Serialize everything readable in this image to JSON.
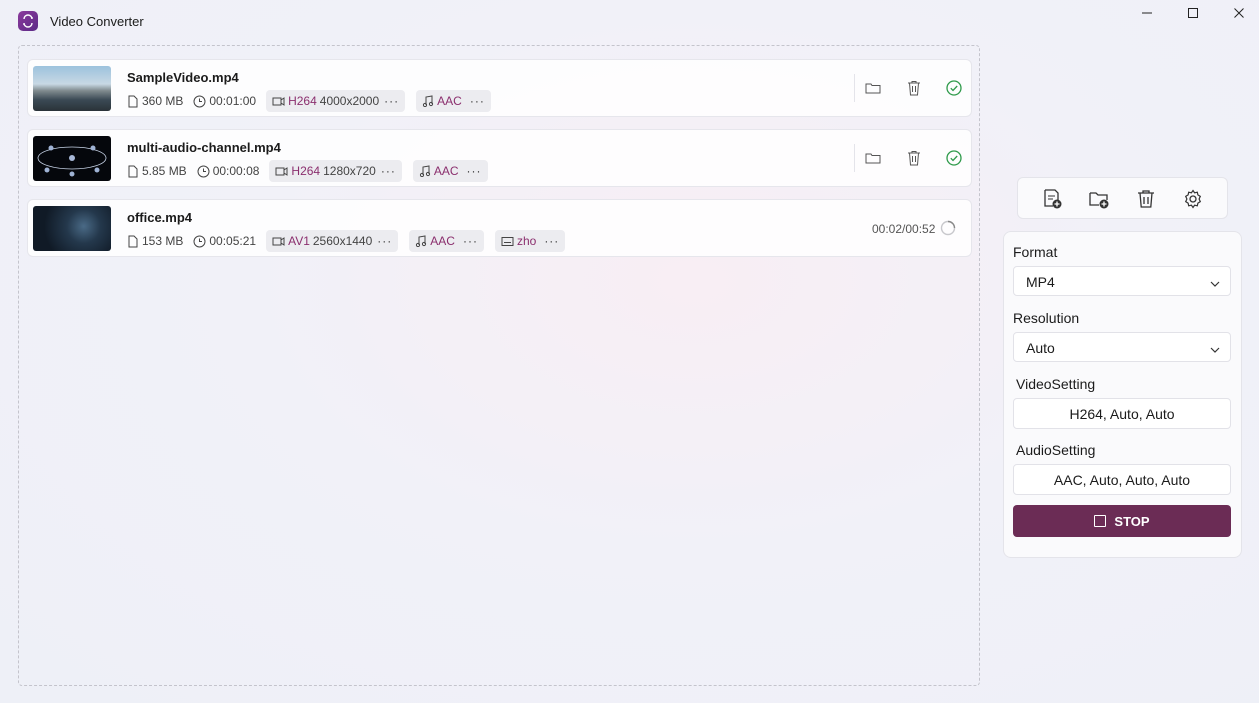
{
  "app": {
    "title": "Video Converter"
  },
  "window_controls": [
    "minimize-icon",
    "maximize-icon",
    "close-icon"
  ],
  "files": [
    {
      "name": "SampleVideo.mp4",
      "size": "360 MB",
      "duration": "00:01:00",
      "video_codec": "H264",
      "video_res": "4000x2000",
      "audio_codec": "AAC",
      "subtitle": "",
      "status": "done",
      "progress": ""
    },
    {
      "name": "multi-audio-channel.mp4",
      "size": "5.85 MB",
      "duration": "00:00:08",
      "video_codec": "H264",
      "video_res": "1280x720",
      "audio_codec": "AAC",
      "subtitle": "",
      "status": "done",
      "progress": ""
    },
    {
      "name": "office.mp4",
      "size": "153 MB",
      "duration": "00:05:21",
      "video_codec": "AV1",
      "video_res": "2560x1440",
      "audio_codec": "AAC",
      "subtitle": "zho",
      "status": "converting",
      "progress": "00:02/00:52"
    }
  ],
  "pill_more": "···",
  "toolbar": [
    "add-file-icon",
    "add-folder-icon",
    "clear-all-icon",
    "settings-icon"
  ],
  "settings": {
    "format_label": "Format",
    "format_value": "MP4",
    "resolution_label": "Resolution",
    "resolution_value": "Auto",
    "video_label": "VideoSetting",
    "video_value": "H264, Auto, Auto",
    "audio_label": "AudioSetting",
    "audio_value": "AAC, Auto, Auto, Auto",
    "stop_label": "STOP"
  },
  "colors": {
    "accent": "#6b2c55",
    "codec": "#8b2f6e",
    "done": "#2e9a4a"
  }
}
